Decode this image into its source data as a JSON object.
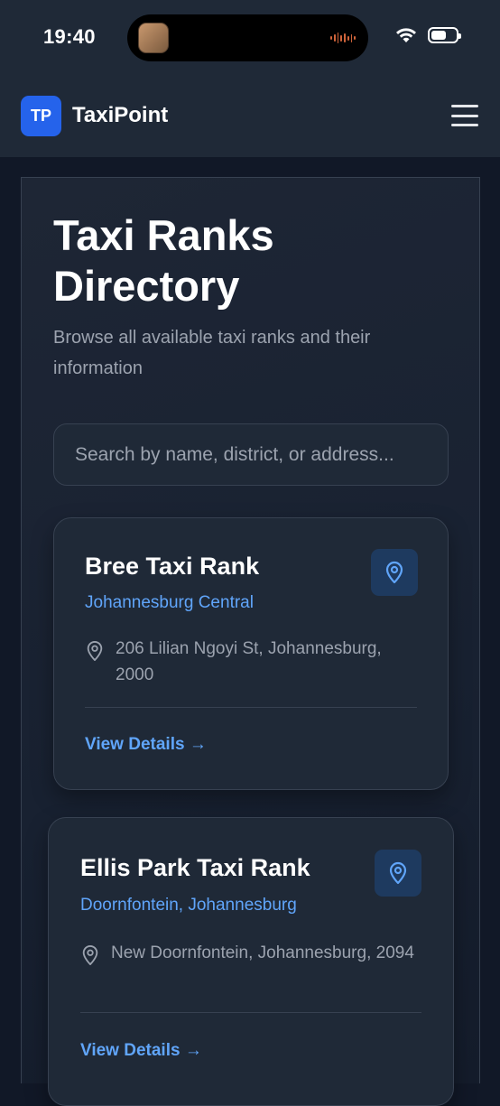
{
  "status_bar": {
    "time": "19:40",
    "battery_level": 0.6
  },
  "header": {
    "logo_text": "TP",
    "brand_name": "TaxiPoint"
  },
  "page": {
    "title": "Taxi Ranks Directory",
    "subtitle": "Browse all available taxi ranks and their information"
  },
  "search": {
    "placeholder": "Search by name, district, or address..."
  },
  "ranks": [
    {
      "name": "Bree Taxi Rank",
      "district": "Johannesburg Central",
      "address": "206 Lilian Ngoyi St, Johannesburg, 2000",
      "link_label": "View Details →"
    },
    {
      "name": "Ellis Park Taxi Rank",
      "district": "Doornfontein, Johannesburg",
      "address": "New Doornfontein, Johannesburg, 2094",
      "link_label": "View Details →"
    }
  ],
  "colors": {
    "background": "#111827",
    "surface": "#1f2937",
    "accent": "#2563eb",
    "link": "#60a5fa",
    "muted_text": "#9ca3af"
  },
  "icons": {
    "status": [
      "wifi-icon",
      "battery-icon"
    ],
    "header": [
      "hamburger-menu-icon"
    ],
    "card": [
      "location-pin-icon"
    ]
  }
}
